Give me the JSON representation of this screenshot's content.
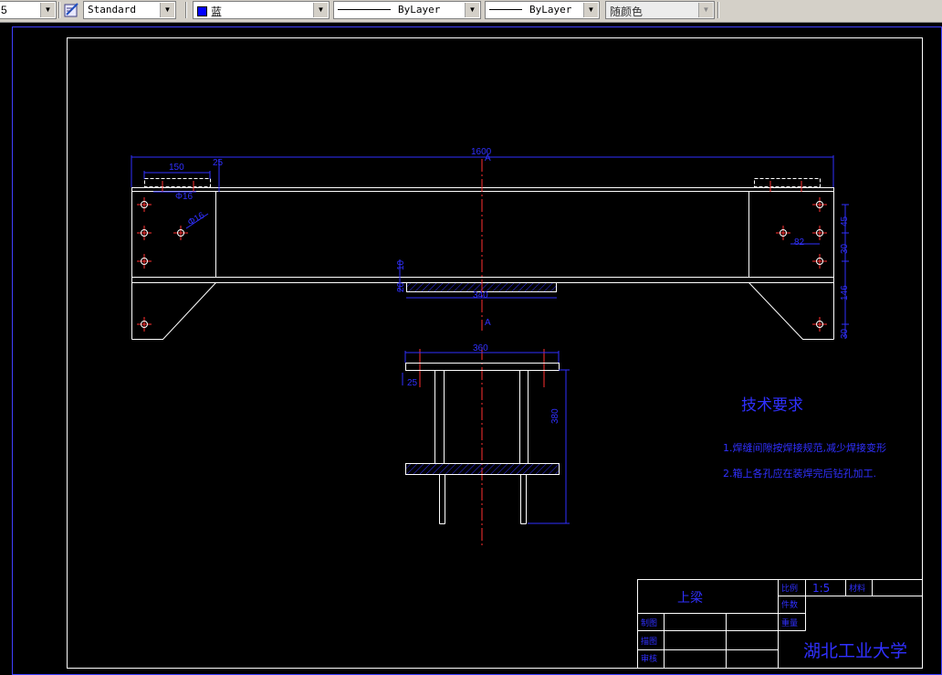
{
  "toolbar": {
    "partial_left": "5",
    "text_style": "Standard",
    "color": "蓝",
    "color_hex": "#0000ff",
    "linetype": "ByLayer",
    "lineweight": "ByLayer",
    "plot_style": "随颜色"
  },
  "drawing": {
    "dims": {
      "overall_length": "1600",
      "left_hole_span": "150",
      "top_thickness": "25",
      "hole_dia_a": "Φ16",
      "hole_dia_b": "Φ16",
      "right_v1": "45",
      "right_h": "82",
      "right_v2": "30",
      "right_v3": "146",
      "right_v4": "30",
      "plate_h": "10",
      "plate_h2": "20",
      "plate_width": "340",
      "section_mark": "A",
      "section_width": "360",
      "flange_t": "25",
      "web_height": "380"
    },
    "tech_title": "技术要求",
    "tech_items": [
      "1.焊缝间隙按焊接规范,减少焊接变形",
      "2.箱上各孔应在装焊完后钻孔加工."
    ],
    "title_block": {
      "part_name": "上梁",
      "scale_label": "比例",
      "scale_value": "1:5",
      "material_label": "材料",
      "count_label": "件数",
      "weight_label": "重量",
      "drawn_label": "制图",
      "draw_label": "描图",
      "check_label": "审核",
      "school": "湖北工业大学"
    }
  }
}
